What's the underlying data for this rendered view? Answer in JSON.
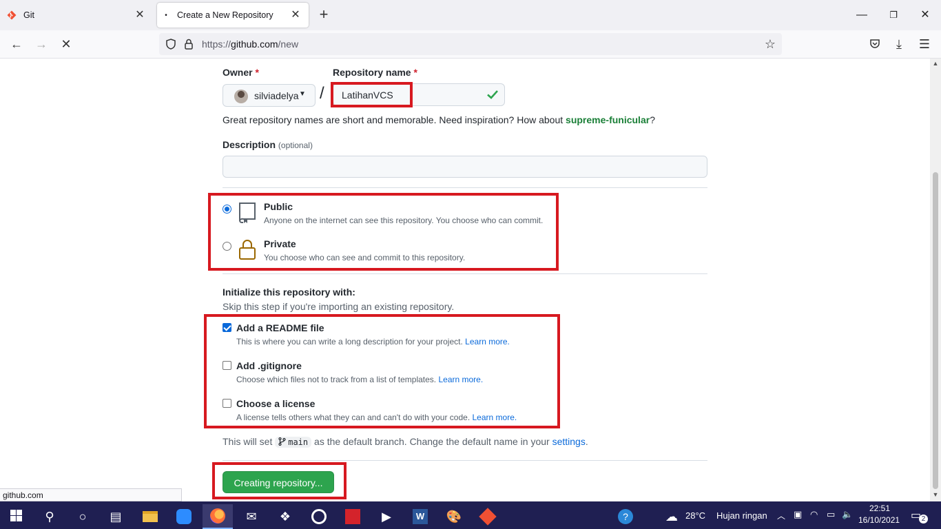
{
  "browser": {
    "tabs": [
      {
        "title": "Git",
        "active": false
      },
      {
        "title": "Create a New Repository",
        "active": true
      }
    ],
    "url_prefix": "https://",
    "url_host": "github.com",
    "url_path": "/new",
    "status_url": "github.com"
  },
  "form": {
    "owner_label": "Owner",
    "repo_label": "Repository name",
    "required_mark": "*",
    "owner_value": "silviadelya",
    "slash": "/",
    "repo_value": "LatihanVCS",
    "name_hint_prefix": "Great repository names are short and memorable. Need inspiration? How about ",
    "name_hint_suggestion": "supreme-funicular",
    "name_hint_suffix": "?",
    "description_label": "Description",
    "description_optional": "(optional)",
    "description_value": ""
  },
  "visibility": {
    "public_title": "Public",
    "public_note": "Anyone on the internet can see this repository. You choose who can commit.",
    "private_title": "Private",
    "private_note": "You choose who can see and commit to this repository.",
    "selected": "public"
  },
  "init": {
    "heading": "Initialize this repository with:",
    "subheading": "Skip this step if you're importing an existing repository.",
    "options": [
      {
        "title": "Add a README file",
        "note": "This is where you can write a long description for your project.",
        "link": "Learn more.",
        "checked": true
      },
      {
        "title": "Add .gitignore",
        "note": "Choose which files not to track from a list of templates.",
        "link": "Learn more.",
        "checked": false
      },
      {
        "title": "Choose a license",
        "note": "A license tells others what they can and can't do with your code.",
        "link": "Learn more.",
        "checked": false
      }
    ],
    "branch_prefix": "This will set ",
    "branch_name": "main",
    "branch_middle": " as the default branch. Change the default name in your ",
    "branch_link": "settings",
    "branch_suffix": "."
  },
  "submit_label": "Creating repository...",
  "taskbar": {
    "weather_temp": "28°C",
    "weather_text": "Hujan ringan",
    "time": "22:51",
    "date": "16/10/2021",
    "notification_count": "2"
  },
  "colors": {
    "github_green": "#2da44e",
    "link_blue": "#0969da",
    "annotation_red": "#d71920",
    "taskbar": "#1f1f52"
  }
}
